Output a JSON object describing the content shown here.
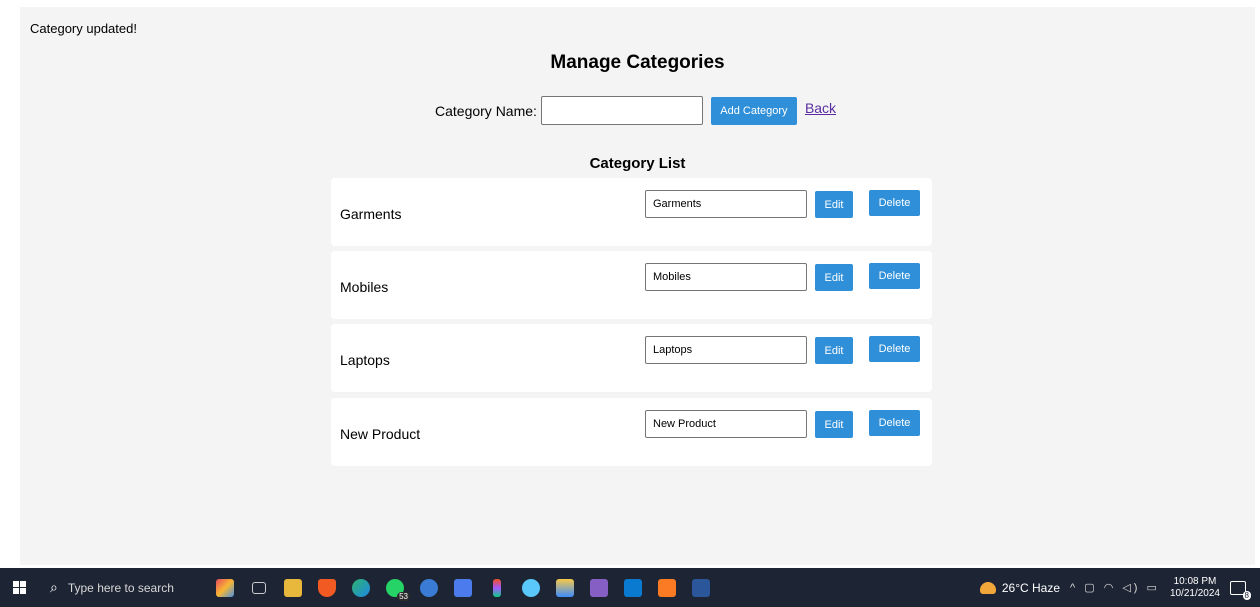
{
  "flash_message": "Category updated!",
  "page_title": "Manage Categories",
  "add_form": {
    "label": "Category Name:",
    "input_value": "",
    "add_button": "Add Category",
    "back_link": "Back"
  },
  "list_title": "Category List",
  "categories": [
    {
      "name": "Garments",
      "input_value": "Garments",
      "edit_label": "Edit",
      "delete_label": "Delete"
    },
    {
      "name": "Mobiles",
      "input_value": "Mobiles",
      "edit_label": "Edit",
      "delete_label": "Delete"
    },
    {
      "name": "Laptops",
      "input_value": "Laptops",
      "edit_label": "Edit",
      "delete_label": "Delete"
    },
    {
      "name": "New Product",
      "input_value": "New Product",
      "edit_label": "Edit",
      "delete_label": "Delete"
    }
  ],
  "taskbar": {
    "search_placeholder": "Type here to search",
    "whatsapp_badge": "53",
    "weather": "26°C  Haze",
    "time": "10:08 PM",
    "date": "10/21/2024",
    "notification_count": "8",
    "apps": [
      "paint-icon",
      "task-view-icon",
      "file-explorer-icon",
      "brave-icon",
      "edge-icon",
      "whatsapp-icon",
      "app-store-icon",
      "app-icon",
      "figma-icon",
      "app-icon",
      "app-icon",
      "visual-studio-icon",
      "vscode-icon",
      "xampp-icon",
      "word-icon"
    ],
    "accent_colors": {
      "button": "#2f8fd8",
      "taskbar": "#1d2434"
    }
  }
}
